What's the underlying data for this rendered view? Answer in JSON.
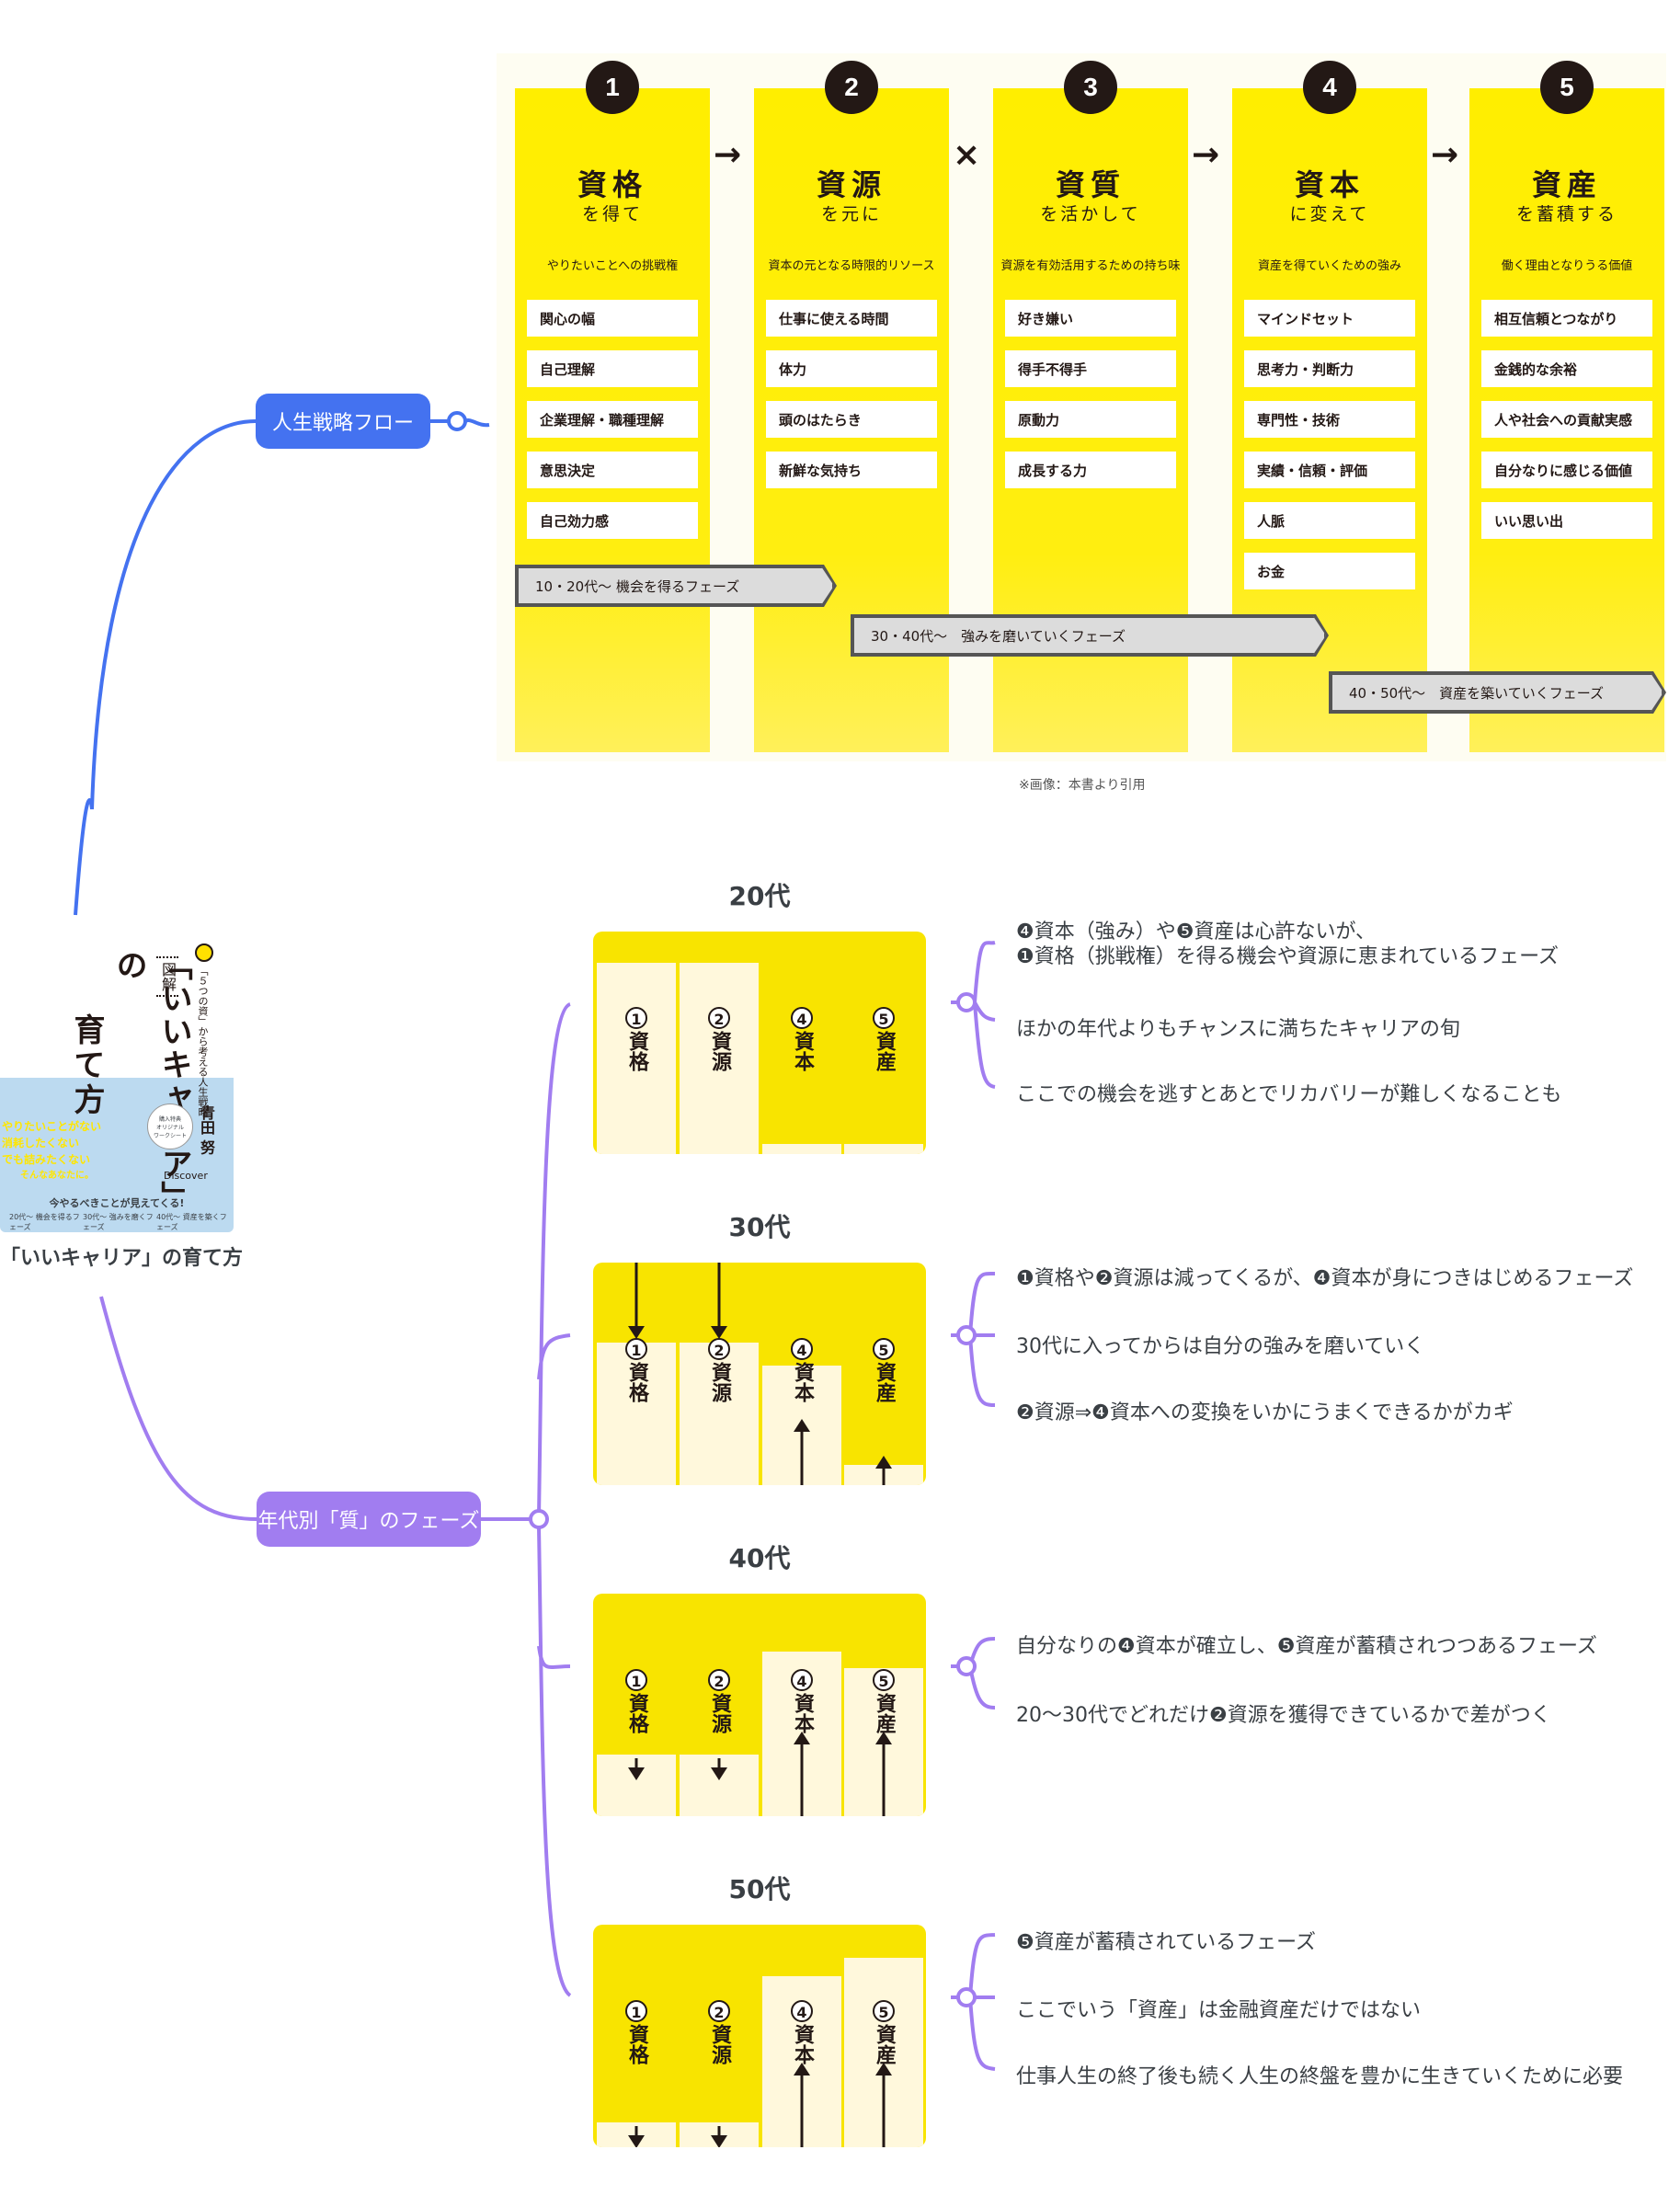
{
  "mindmap": {
    "root": {
      "label": "「いいキャリア」の育て方"
    },
    "branch_flow": {
      "label": "人生戦略フロー"
    },
    "branch_phase": {
      "label": "年代別「質」のフェーズ"
    }
  },
  "book": {
    "tag": "図解",
    "title_main": "「いいキャリア」の",
    "title_sub": "育て方",
    "subtitle": "「５つの資」から考える人生戦略",
    "author": "青田 努",
    "bonus": [
      "購入特典",
      "オリジナル",
      "ワークシート"
    ],
    "catch": [
      "やりたいことがない",
      "消耗したくない",
      "でも詰みたくない",
      "そんなあなたに。"
    ],
    "band": "今やるべきことが見えてくる!",
    "phases": [
      "20代〜 機会を得るフェーズ",
      "30代〜 強みを磨くフェーズ",
      "40代〜 資産を築くフェーズ"
    ],
    "publisher": "Discover"
  },
  "flow": {
    "columns": [
      {
        "num": "1",
        "title": "資格",
        "sub": "を得て",
        "desc": "やりたいことへの挑戦権",
        "items": [
          "関心の幅",
          "自己理解",
          "企業理解・職種理解",
          "意思決定",
          "自己効力感"
        ]
      },
      {
        "num": "2",
        "title": "資源",
        "sub": "を元に",
        "desc": "資本の元となる時限的リソース",
        "items": [
          "仕事に使える時間",
          "体力",
          "頭のはたらき",
          "新鮮な気持ち"
        ]
      },
      {
        "num": "3",
        "title": "資質",
        "sub": "を活かして",
        "desc": "資源を有効活用するための持ち味",
        "items": [
          "好き嫌い",
          "得手不得手",
          "原動力",
          "成長する力"
        ]
      },
      {
        "num": "4",
        "title": "資本",
        "sub": "に変えて",
        "desc": "資産を得ていくための強み",
        "items": [
          "マインドセット",
          "思考力・判断力",
          "専門性・技術",
          "実績・信頼・評価",
          "人脈",
          "お金"
        ]
      },
      {
        "num": "5",
        "title": "資産",
        "sub": "を蓄積する",
        "desc": "働く理由となりうる価値",
        "items": [
          "相互信頼とつながり",
          "金銭的な余裕",
          "人や社会への貢献実感",
          "自分なりに感じる価値",
          "いい思い出"
        ]
      }
    ],
    "operators": [
      "→",
      "×",
      "→",
      "→"
    ],
    "phases": [
      "10・20代〜 機会を得るフェーズ",
      "30・40代〜　強みを磨いていくフェーズ",
      "40・50代〜　資産を築いていくフェーズ"
    ],
    "caption": "※画像：本書より引用"
  },
  "decades": [
    {
      "title": "20代",
      "bars": [
        {
          "num": "1",
          "label": "資格",
          "level": 0.93,
          "arrow": "none"
        },
        {
          "num": "2",
          "label": "資源",
          "level": 0.93,
          "arrow": "none"
        },
        {
          "num": "4",
          "label": "資本",
          "level": 0.05,
          "arrow": "none"
        },
        {
          "num": "5",
          "label": "資産",
          "level": 0.05,
          "arrow": "none"
        }
      ],
      "notes": [
        "❹資本（強み）や❺資産は心許ないが、",
        "❶資格（挑戦権）を得る機会や資源に恵まれているフェーズ",
        "ほかの年代よりもチャンスに満ちたキャリアの旬",
        "ここでの機会を逃すとあとでリカバリーが難しくなることも"
      ]
    },
    {
      "title": "30代",
      "bars": [
        {
          "num": "1",
          "label": "資格",
          "level": 0.69,
          "arrow": "down"
        },
        {
          "num": "2",
          "label": "資源",
          "level": 0.69,
          "arrow": "down"
        },
        {
          "num": "4",
          "label": "資本",
          "level": 0.58,
          "arrow": "up"
        },
        {
          "num": "5",
          "label": "資産",
          "level": 0.1,
          "arrow": "up"
        }
      ],
      "notes": [
        "❶資格や❷資源は減ってくるが、❹資本が身につきはじめるフェーズ",
        "30代に入ってからは自分の強みを磨いていく",
        "❷資源⇒❹資本への変換をいかにうまくできるかがカギ"
      ]
    },
    {
      "title": "40代",
      "bars": [
        {
          "num": "1",
          "label": "資格",
          "level": 0.3,
          "arrow": "down"
        },
        {
          "num": "2",
          "label": "資源",
          "level": 0.3,
          "arrow": "down"
        },
        {
          "num": "4",
          "label": "資本",
          "level": 0.8,
          "arrow": "up"
        },
        {
          "num": "5",
          "label": "資産",
          "level": 0.72,
          "arrow": "up"
        }
      ],
      "notes": [
        "自分なりの❹資本が確立し、❺資産が蓄積されつつあるフェーズ",
        "20〜30代でどれだけ❷資源を獲得できているかで差がつく"
      ]
    },
    {
      "title": "50代",
      "bars": [
        {
          "num": "1",
          "label": "資格",
          "level": 0.12,
          "arrow": "down"
        },
        {
          "num": "2",
          "label": "資源",
          "level": 0.12,
          "arrow": "down"
        },
        {
          "num": "4",
          "label": "資本",
          "level": 0.83,
          "arrow": "up"
        },
        {
          "num": "5",
          "label": "資産",
          "level": 0.92,
          "arrow": "up"
        }
      ],
      "notes": [
        "❺資産が蓄積されているフェーズ",
        "ここでいう「資産」は金融資産だけではない",
        "仕事人生の終了後も続く人生の終盤を豊かに生きていくために必要"
      ]
    }
  ],
  "colors": {
    "flow_branch": "#4472f0",
    "phase_branch": "#a17df0",
    "yellow": "#f8e400"
  }
}
